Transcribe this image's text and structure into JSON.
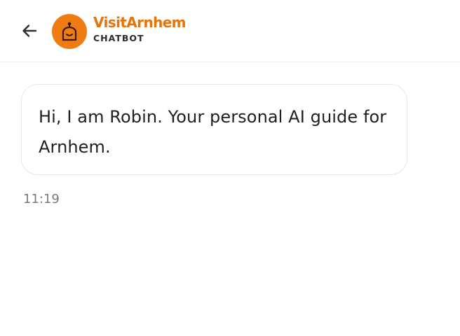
{
  "colors": {
    "brand": "#e8730a",
    "avatar_bg": "#ee7c12",
    "text": "#1f1f1f",
    "muted": "#7a7a7a",
    "divider": "#ececec"
  },
  "header": {
    "back_icon": "arrow-left-icon",
    "avatar_icon": "robot-icon",
    "brand_name": "VisitArnhem",
    "subtitle": "CHATBOT"
  },
  "messages": [
    {
      "text": "Hi, I am Robin. Your personal AI guide for Arnhem.",
      "time": "11:19"
    }
  ]
}
